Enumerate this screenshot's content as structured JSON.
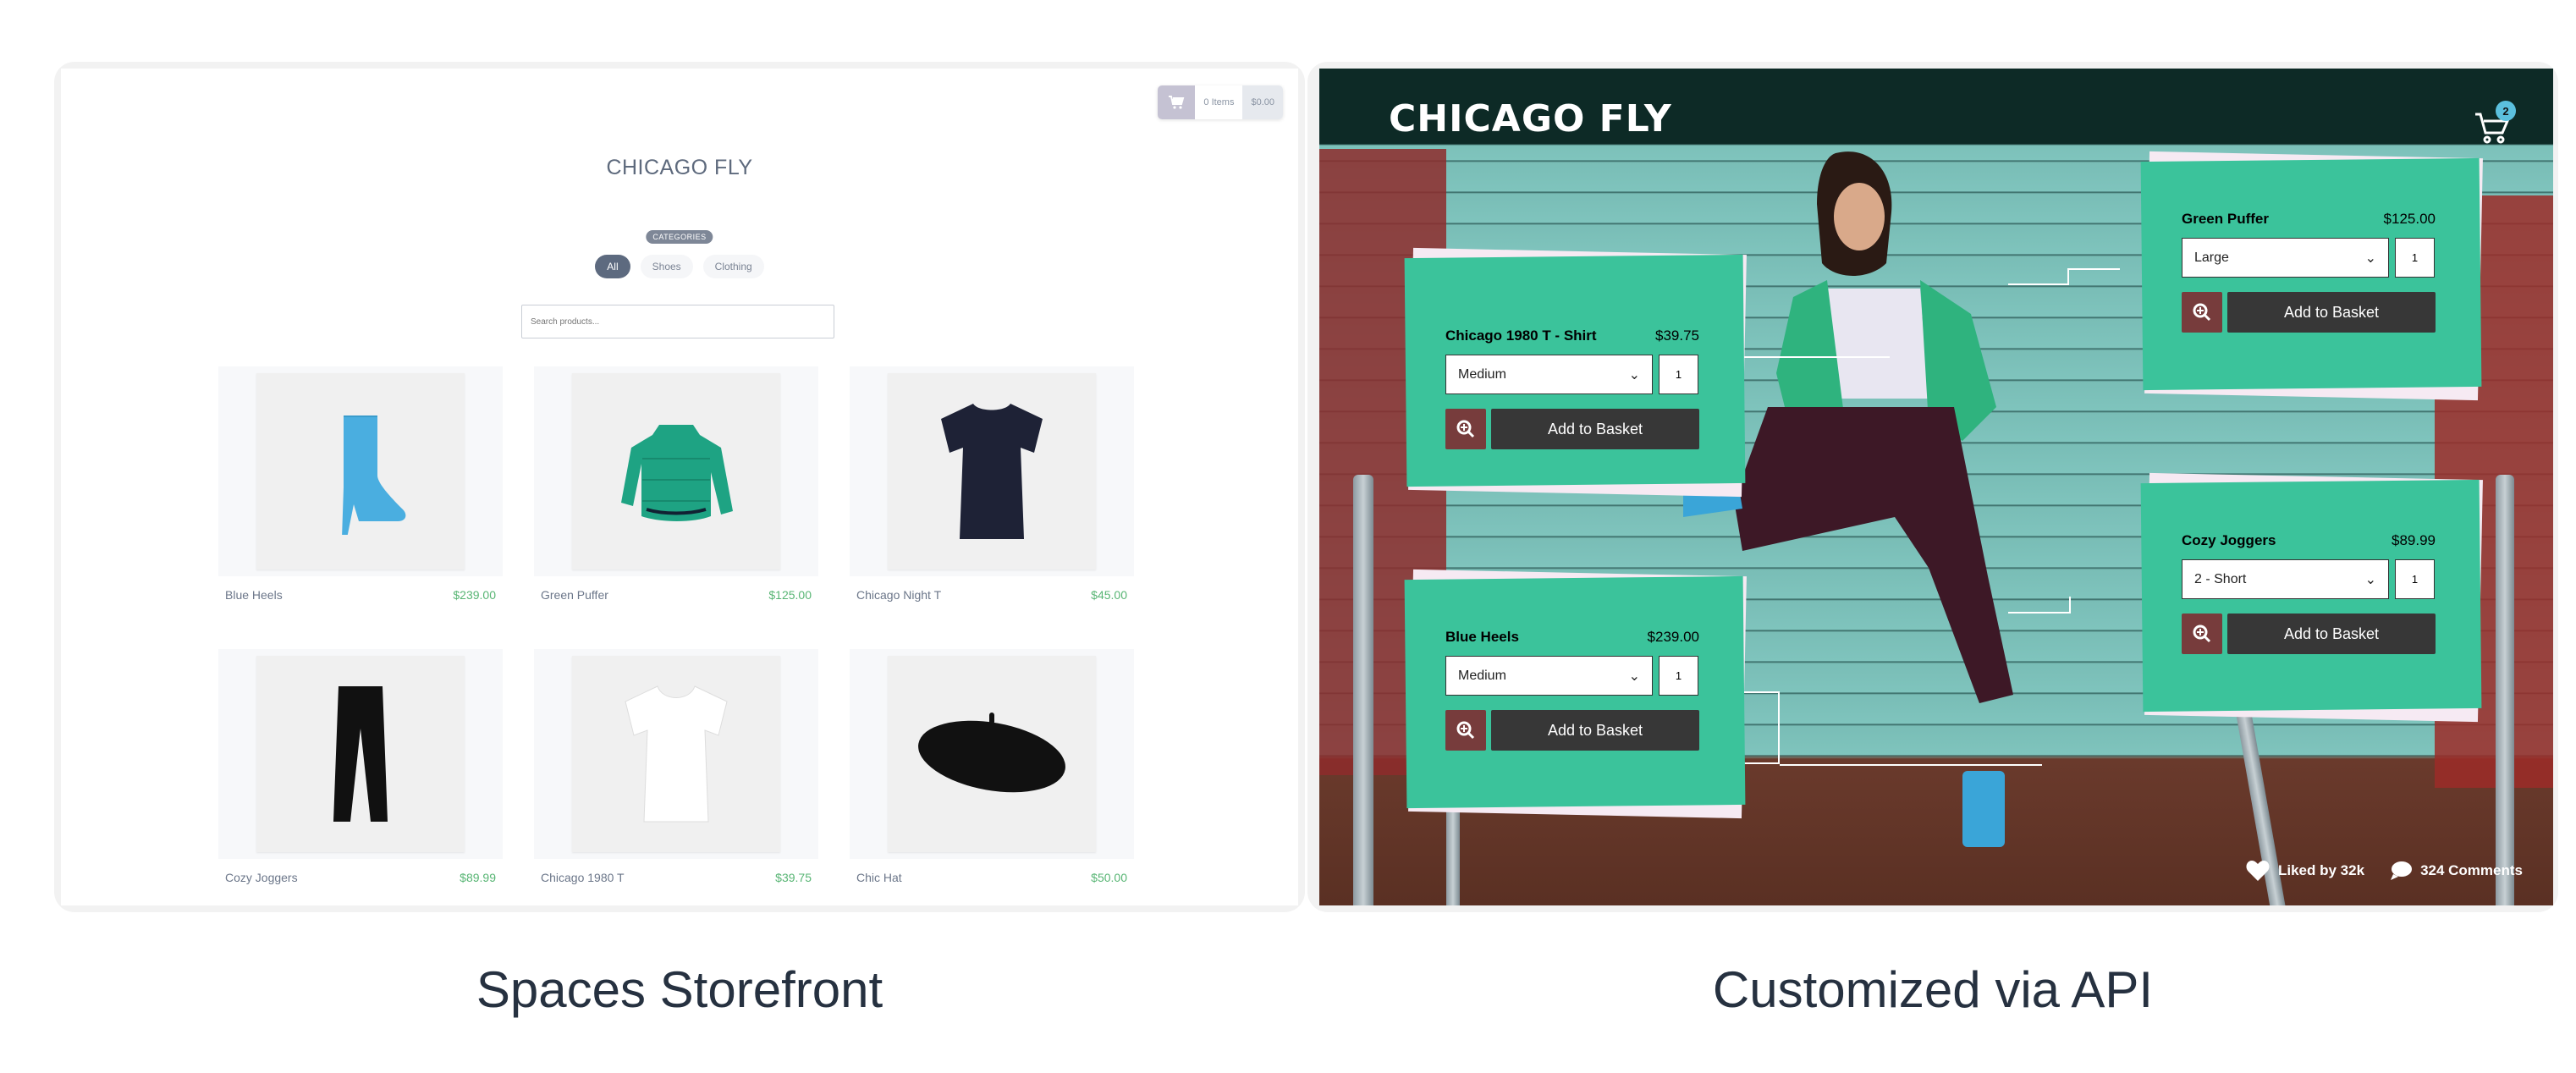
{
  "storefront": {
    "cart": {
      "items": "0 Items",
      "total": "$0.00",
      "icon": "cart-icon"
    },
    "title": "CHICAGO FLY",
    "categories_label": "CATEGORIES",
    "categories": [
      {
        "label": "All",
        "active": true
      },
      {
        "label": "Shoes",
        "active": false
      },
      {
        "label": "Clothing",
        "active": false
      }
    ],
    "search_placeholder": "Search products...",
    "products": [
      {
        "name": "Blue Heels",
        "price": "$239.00",
        "image": "blue-heel-boot"
      },
      {
        "name": "Green Puffer",
        "price": "$125.00",
        "image": "green-puffer-jacket"
      },
      {
        "name": "Chicago Night T",
        "price": "$45.00",
        "image": "navy-t-shirt"
      },
      {
        "name": "Cozy Joggers",
        "price": "$89.99",
        "image": "black-joggers"
      },
      {
        "name": "Chicago 1980 T",
        "price": "$39.75",
        "image": "white-t-shirt"
      },
      {
        "name": "Chic Hat",
        "price": "$50.00",
        "image": "black-beret"
      }
    ]
  },
  "custom": {
    "title": "CHICAGO FLY",
    "cart_count": "2",
    "cards": [
      {
        "name": "Chicago 1980 T - Shirt",
        "price": "$39.75",
        "option": "Medium",
        "qty": "1",
        "button": "Add to Basket"
      },
      {
        "name": "Green Puffer",
        "price": "$125.00",
        "option": "Large",
        "qty": "1",
        "button": "Add to Basket"
      },
      {
        "name": "Blue Heels",
        "price": "$239.00",
        "option": "Medium",
        "qty": "1",
        "button": "Add to Basket"
      },
      {
        "name": "Cozy Joggers",
        "price": "$89.99",
        "option": "2 - Short",
        "qty": "1",
        "button": "Add to Basket"
      }
    ],
    "likes": "Liked by 32k",
    "comments": "324 Comments",
    "colors": {
      "card": "#3bc39b",
      "zoom_button": "#773c3c",
      "add_button": "#373737",
      "badge": "#5bc0de"
    }
  },
  "captions": {
    "left": "Spaces Storefront",
    "right": "Customized via API"
  }
}
